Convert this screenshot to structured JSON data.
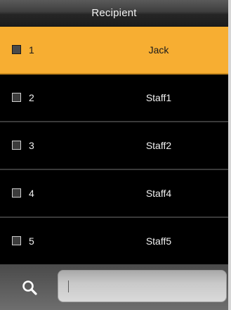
{
  "header": {
    "title": "Recipient"
  },
  "rows": [
    {
      "number": "1",
      "name": "Jack",
      "selected": true
    },
    {
      "number": "2",
      "name": "Staff1",
      "selected": false
    },
    {
      "number": "3",
      "name": "Staff2",
      "selected": false
    },
    {
      "number": "4",
      "name": "Staff4",
      "selected": false
    },
    {
      "number": "5",
      "name": "Staff5",
      "selected": false
    }
  ],
  "search": {
    "icon": "search-icon",
    "value": ""
  },
  "colors": {
    "highlight": "#f7ae32",
    "background": "#000000",
    "text": "#f0f0f0"
  }
}
